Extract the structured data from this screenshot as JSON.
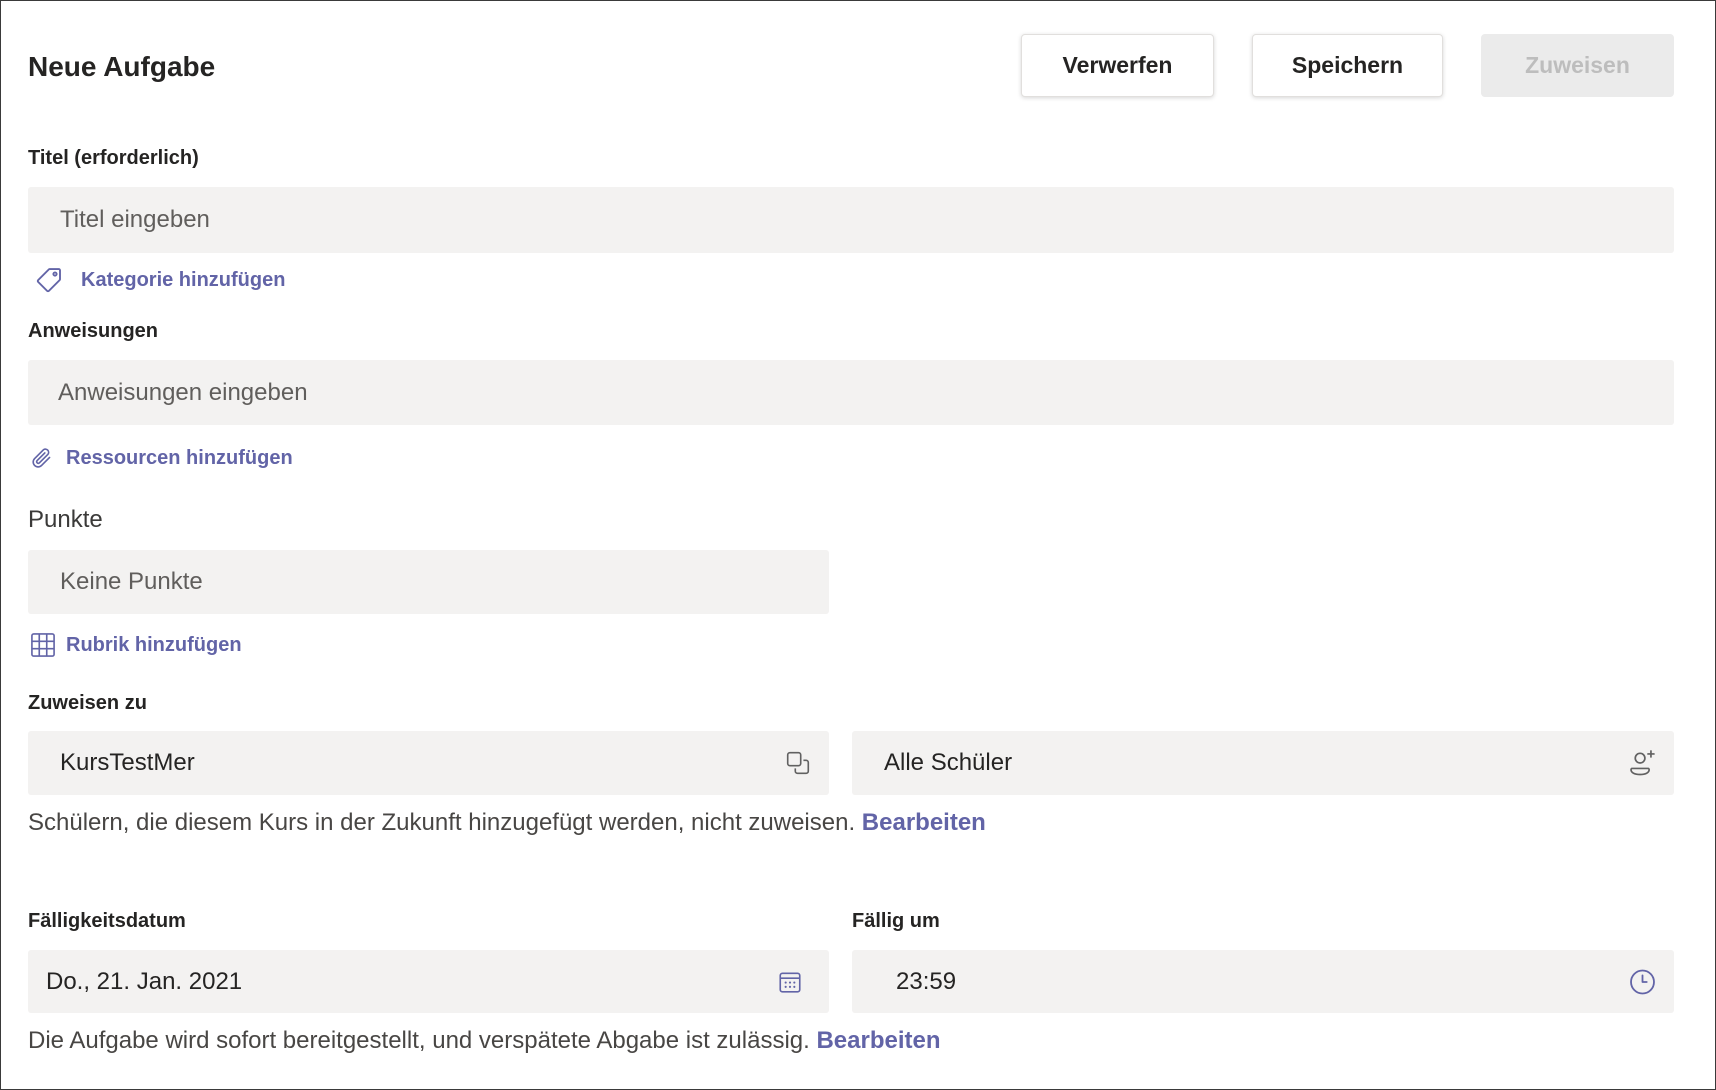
{
  "header": {
    "title": "Neue Aufgabe",
    "buttons": {
      "discard": "Verwerfen",
      "save": "Speichern",
      "assign": "Zuweisen"
    }
  },
  "title_field": {
    "label": "Titel (erforderlich)",
    "placeholder": "Titel eingeben",
    "value": ""
  },
  "category_link": {
    "label": "Kategorie hinzufügen",
    "icon": "tag-icon"
  },
  "instructions_field": {
    "label": "Anweisungen",
    "placeholder": "Anweisungen eingeben",
    "value": ""
  },
  "resources_link": {
    "label": "Ressourcen hinzufügen",
    "icon": "paperclip-icon"
  },
  "points_field": {
    "label": "Punkte",
    "placeholder": "Keine Punkte",
    "value": ""
  },
  "rubric_link": {
    "label": "Rubrik hinzufügen",
    "icon": "grid-icon"
  },
  "assign_to": {
    "label": "Zuweisen zu",
    "class_select": {
      "value": "KursTestMer",
      "icon": "switch-class-icon"
    },
    "students_select": {
      "value": "Alle Schüler",
      "icon": "add-person-icon"
    },
    "note": "Schülern, die diesem Kurs in der Zukunft hinzugefügt werden, nicht zuweisen.",
    "note_link": "Bearbeiten"
  },
  "due_date": {
    "label": "Fälligkeitsdatum",
    "value": "Do., 21. Jan. 2021",
    "icon": "calendar-icon"
  },
  "due_time": {
    "label": "Fällig um",
    "value": "23:59",
    "icon": "clock-icon"
  },
  "schedule_note": {
    "text": "Die Aufgabe wird sofort bereitgestellt, und verspätete Abgabe ist zulässig.",
    "link": "Bearbeiten"
  },
  "colors": {
    "accent": "#6264a7",
    "field_background": "#f3f2f1",
    "text": "#252423",
    "placeholder": "#605e5c",
    "disabled_button_background": "#ebebeb",
    "disabled_button_text": "#bdbdbd"
  }
}
